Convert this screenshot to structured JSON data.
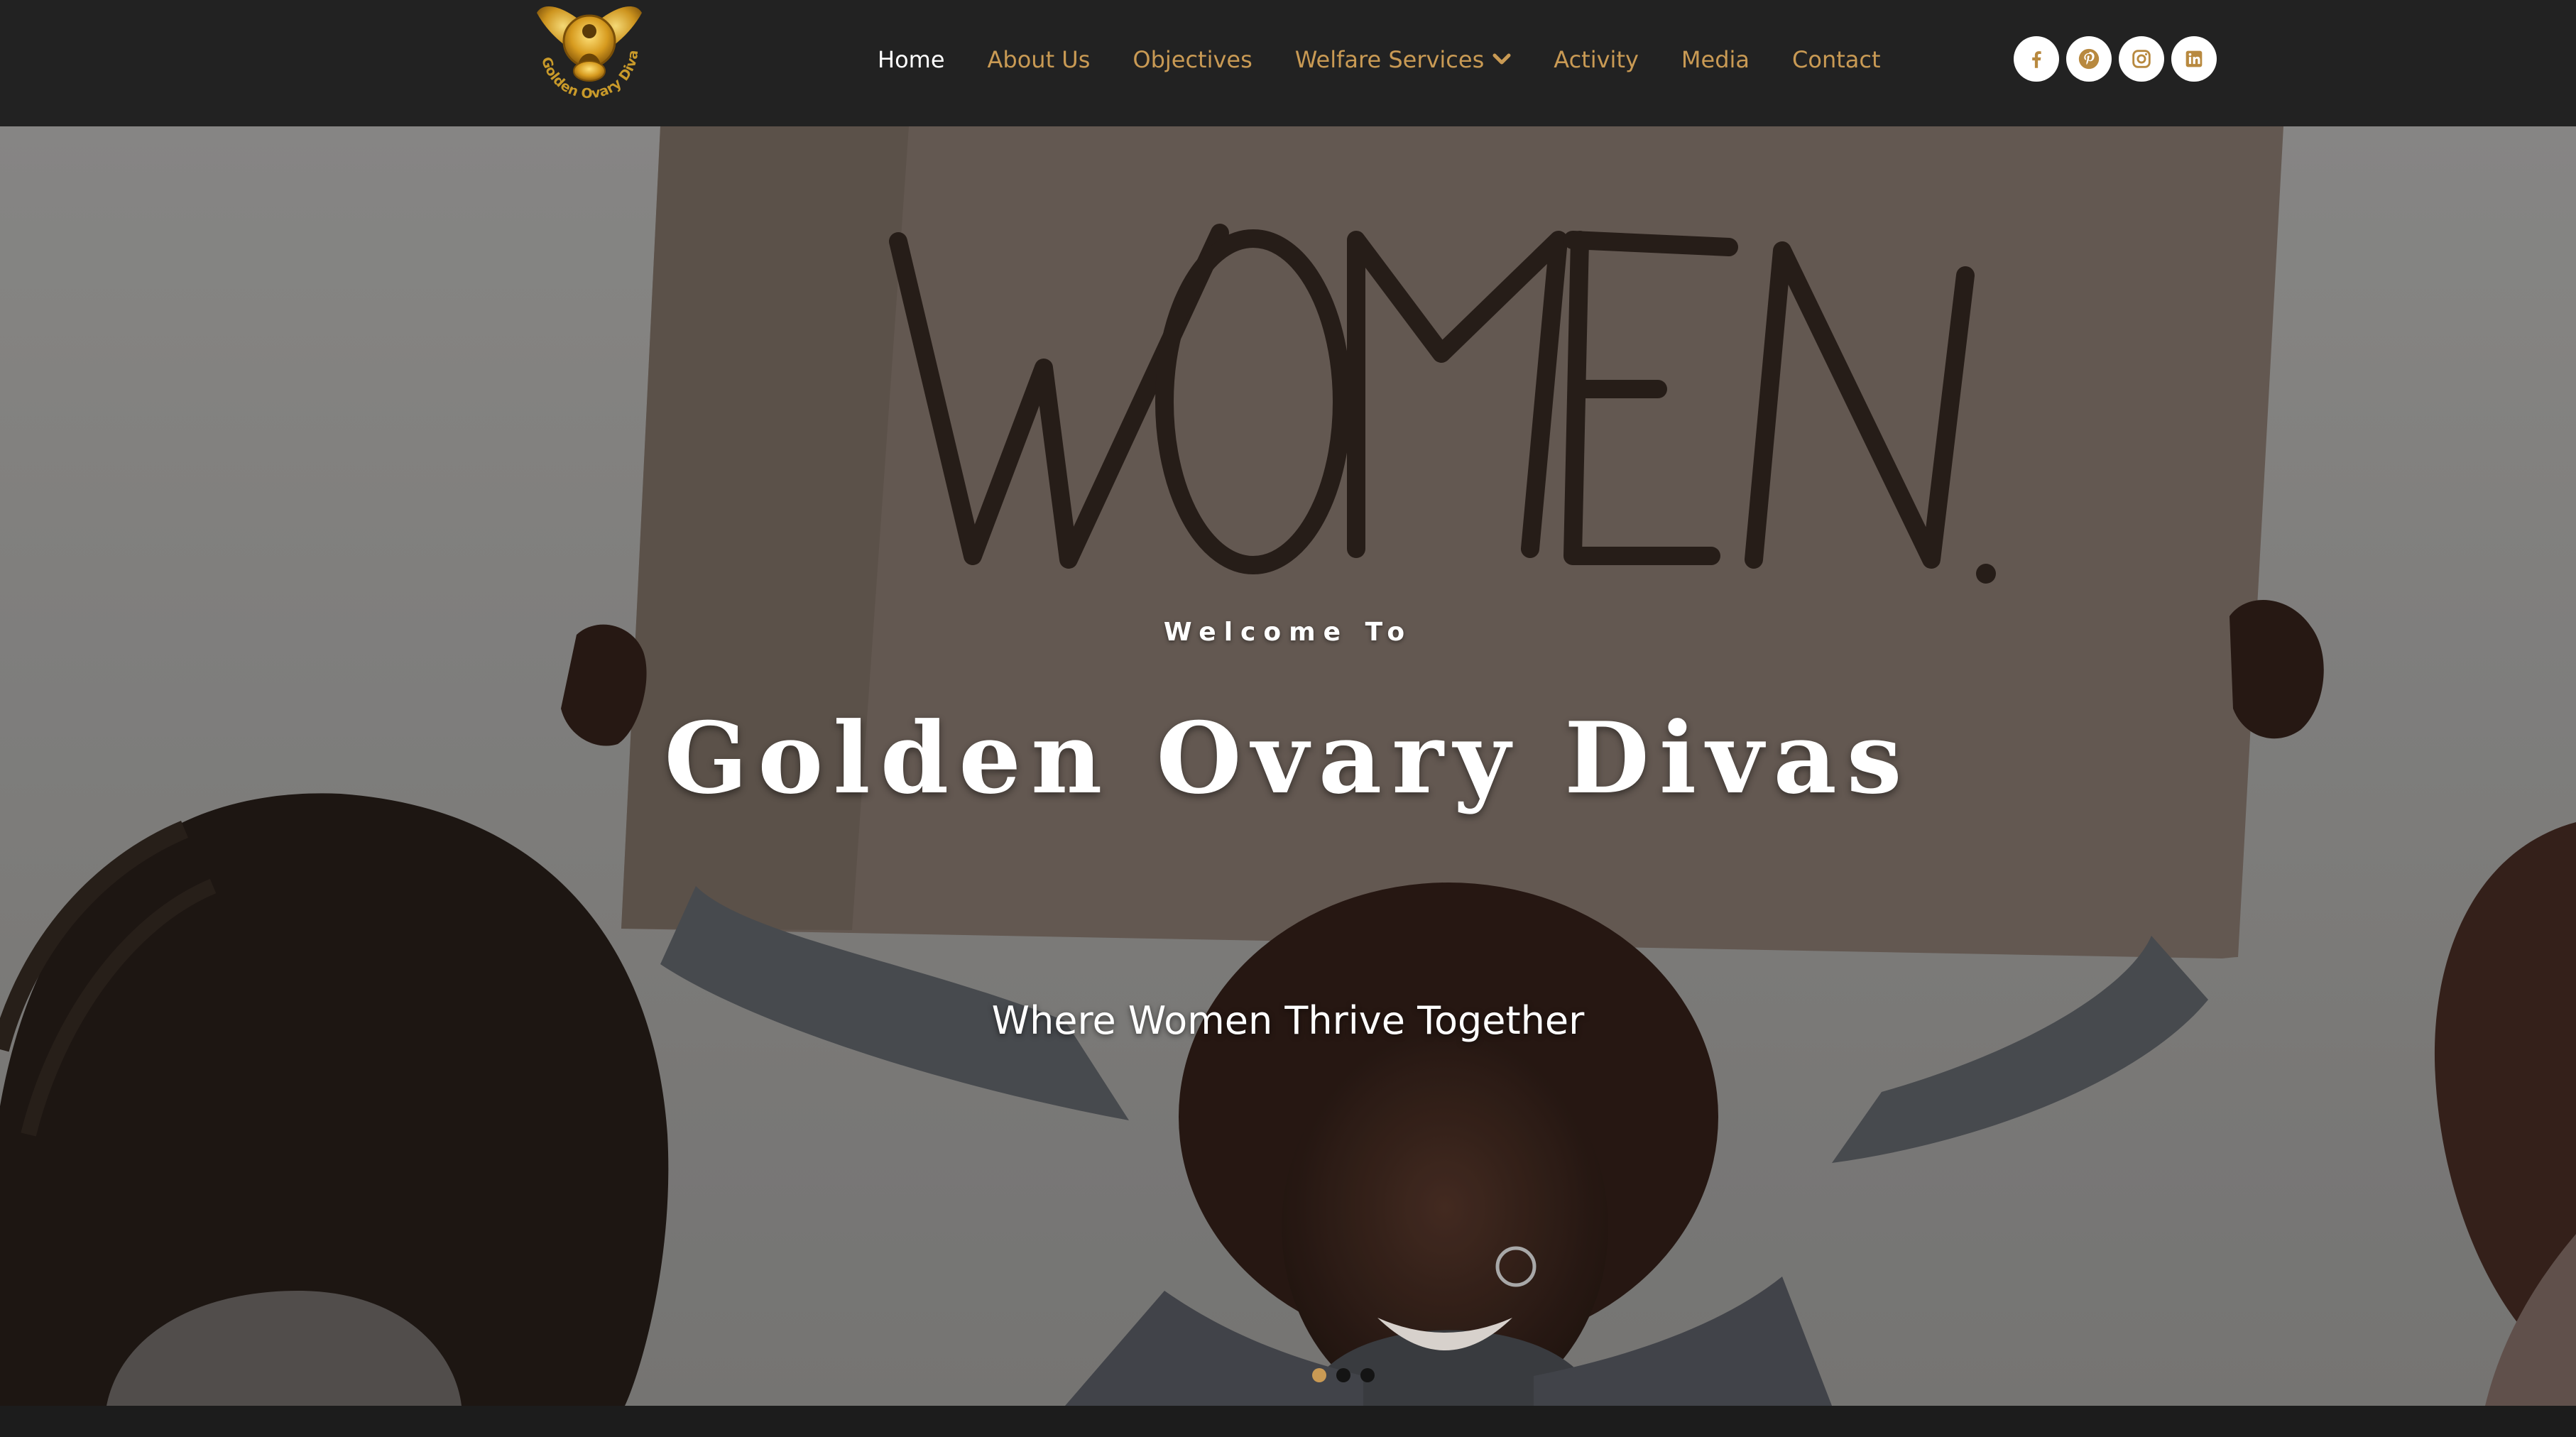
{
  "header": {
    "logo_text": "Golden Ovary Divas",
    "nav": [
      {
        "label": "Home",
        "active": true
      },
      {
        "label": "About Us",
        "active": false
      },
      {
        "label": "Objectives",
        "active": false
      },
      {
        "label": "Welfare Services",
        "active": false,
        "icon": "chevron-down-icon"
      },
      {
        "label": "Activity",
        "active": false
      },
      {
        "label": "Media",
        "active": false
      },
      {
        "label": "Contact",
        "active": false
      }
    ],
    "social": [
      {
        "icon": "facebook-icon"
      },
      {
        "icon": "pinterest-icon"
      },
      {
        "icon": "instagram-icon"
      },
      {
        "icon": "linkedin-icon"
      }
    ]
  },
  "hero": {
    "sign_text": "WOMEN.",
    "welcome": "Welcome To",
    "title": "Golden Ovary Divas",
    "tagline": "Where Women Thrive Together",
    "slides": 3,
    "active_slide": 1
  },
  "colors": {
    "accent": "#c99a54",
    "header_bg": "#222222",
    "text_light": "#ffffff"
  }
}
